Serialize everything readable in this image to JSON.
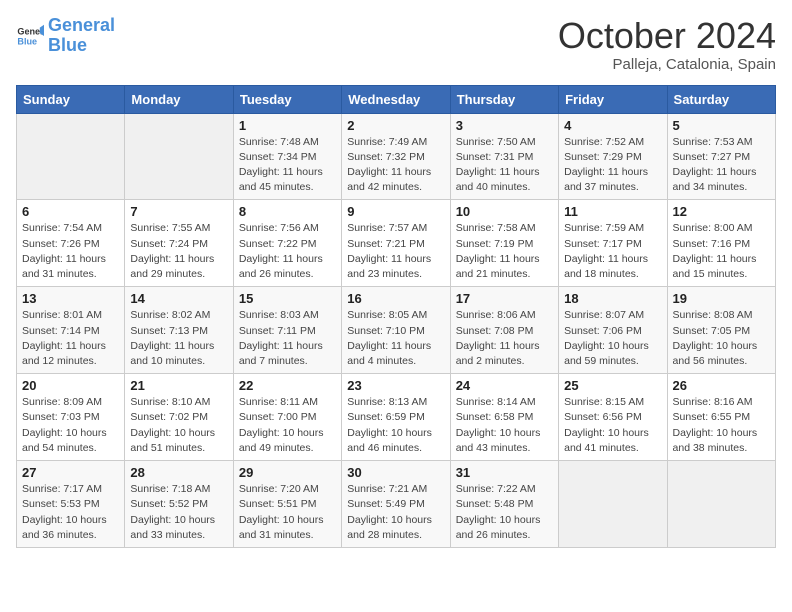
{
  "header": {
    "logo_general": "General",
    "logo_blue": "Blue",
    "month_title": "October 2024",
    "location": "Palleja, Catalonia, Spain"
  },
  "weekdays": [
    "Sunday",
    "Monday",
    "Tuesday",
    "Wednesday",
    "Thursday",
    "Friday",
    "Saturday"
  ],
  "weeks": [
    [
      {
        "day": "",
        "info": ""
      },
      {
        "day": "",
        "info": ""
      },
      {
        "day": "1",
        "info": "Sunrise: 7:48 AM\nSunset: 7:34 PM\nDaylight: 11 hours and 45 minutes."
      },
      {
        "day": "2",
        "info": "Sunrise: 7:49 AM\nSunset: 7:32 PM\nDaylight: 11 hours and 42 minutes."
      },
      {
        "day": "3",
        "info": "Sunrise: 7:50 AM\nSunset: 7:31 PM\nDaylight: 11 hours and 40 minutes."
      },
      {
        "day": "4",
        "info": "Sunrise: 7:52 AM\nSunset: 7:29 PM\nDaylight: 11 hours and 37 minutes."
      },
      {
        "day": "5",
        "info": "Sunrise: 7:53 AM\nSunset: 7:27 PM\nDaylight: 11 hours and 34 minutes."
      }
    ],
    [
      {
        "day": "6",
        "info": "Sunrise: 7:54 AM\nSunset: 7:26 PM\nDaylight: 11 hours and 31 minutes."
      },
      {
        "day": "7",
        "info": "Sunrise: 7:55 AM\nSunset: 7:24 PM\nDaylight: 11 hours and 29 minutes."
      },
      {
        "day": "8",
        "info": "Sunrise: 7:56 AM\nSunset: 7:22 PM\nDaylight: 11 hours and 26 minutes."
      },
      {
        "day": "9",
        "info": "Sunrise: 7:57 AM\nSunset: 7:21 PM\nDaylight: 11 hours and 23 minutes."
      },
      {
        "day": "10",
        "info": "Sunrise: 7:58 AM\nSunset: 7:19 PM\nDaylight: 11 hours and 21 minutes."
      },
      {
        "day": "11",
        "info": "Sunrise: 7:59 AM\nSunset: 7:17 PM\nDaylight: 11 hours and 18 minutes."
      },
      {
        "day": "12",
        "info": "Sunrise: 8:00 AM\nSunset: 7:16 PM\nDaylight: 11 hours and 15 minutes."
      }
    ],
    [
      {
        "day": "13",
        "info": "Sunrise: 8:01 AM\nSunset: 7:14 PM\nDaylight: 11 hours and 12 minutes."
      },
      {
        "day": "14",
        "info": "Sunrise: 8:02 AM\nSunset: 7:13 PM\nDaylight: 11 hours and 10 minutes."
      },
      {
        "day": "15",
        "info": "Sunrise: 8:03 AM\nSunset: 7:11 PM\nDaylight: 11 hours and 7 minutes."
      },
      {
        "day": "16",
        "info": "Sunrise: 8:05 AM\nSunset: 7:10 PM\nDaylight: 11 hours and 4 minutes."
      },
      {
        "day": "17",
        "info": "Sunrise: 8:06 AM\nSunset: 7:08 PM\nDaylight: 11 hours and 2 minutes."
      },
      {
        "day": "18",
        "info": "Sunrise: 8:07 AM\nSunset: 7:06 PM\nDaylight: 10 hours and 59 minutes."
      },
      {
        "day": "19",
        "info": "Sunrise: 8:08 AM\nSunset: 7:05 PM\nDaylight: 10 hours and 56 minutes."
      }
    ],
    [
      {
        "day": "20",
        "info": "Sunrise: 8:09 AM\nSunset: 7:03 PM\nDaylight: 10 hours and 54 minutes."
      },
      {
        "day": "21",
        "info": "Sunrise: 8:10 AM\nSunset: 7:02 PM\nDaylight: 10 hours and 51 minutes."
      },
      {
        "day": "22",
        "info": "Sunrise: 8:11 AM\nSunset: 7:00 PM\nDaylight: 10 hours and 49 minutes."
      },
      {
        "day": "23",
        "info": "Sunrise: 8:13 AM\nSunset: 6:59 PM\nDaylight: 10 hours and 46 minutes."
      },
      {
        "day": "24",
        "info": "Sunrise: 8:14 AM\nSunset: 6:58 PM\nDaylight: 10 hours and 43 minutes."
      },
      {
        "day": "25",
        "info": "Sunrise: 8:15 AM\nSunset: 6:56 PM\nDaylight: 10 hours and 41 minutes."
      },
      {
        "day": "26",
        "info": "Sunrise: 8:16 AM\nSunset: 6:55 PM\nDaylight: 10 hours and 38 minutes."
      }
    ],
    [
      {
        "day": "27",
        "info": "Sunrise: 7:17 AM\nSunset: 5:53 PM\nDaylight: 10 hours and 36 minutes."
      },
      {
        "day": "28",
        "info": "Sunrise: 7:18 AM\nSunset: 5:52 PM\nDaylight: 10 hours and 33 minutes."
      },
      {
        "day": "29",
        "info": "Sunrise: 7:20 AM\nSunset: 5:51 PM\nDaylight: 10 hours and 31 minutes."
      },
      {
        "day": "30",
        "info": "Sunrise: 7:21 AM\nSunset: 5:49 PM\nDaylight: 10 hours and 28 minutes."
      },
      {
        "day": "31",
        "info": "Sunrise: 7:22 AM\nSunset: 5:48 PM\nDaylight: 10 hours and 26 minutes."
      },
      {
        "day": "",
        "info": ""
      },
      {
        "day": "",
        "info": ""
      }
    ]
  ]
}
